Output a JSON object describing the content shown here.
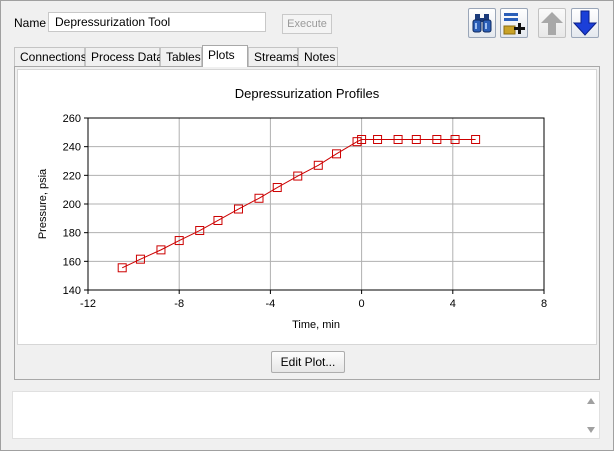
{
  "header": {
    "name_label": "Name",
    "name_value": "Depressurization Tool",
    "execute_label": "Execute"
  },
  "toolbar": {
    "icons": [
      "binoculars-icon",
      "add-note-icon",
      "arrow-up-icon",
      "arrow-down-icon"
    ]
  },
  "tabs": [
    {
      "label": "Connections"
    },
    {
      "label": "Process Data"
    },
    {
      "label": "Tables"
    },
    {
      "label": "Plots",
      "active": true
    },
    {
      "label": "Streams"
    },
    {
      "label": "Notes"
    }
  ],
  "chart_data": {
    "type": "line",
    "title": "Depressurization Profiles",
    "xlabel": "Time, min",
    "ylabel": "Pressure, psia",
    "xlim": [
      -12,
      8
    ],
    "ylim": [
      140,
      260
    ],
    "xticks": [
      -12,
      -8,
      -4,
      0,
      4,
      8
    ],
    "yticks": [
      140,
      160,
      180,
      200,
      220,
      240,
      260
    ],
    "grid": true,
    "color": "#cc0000",
    "series": [
      {
        "marker": "square",
        "x": [
          -10.5,
          -9.7,
          -8.8,
          -8.0,
          -7.1,
          -6.3,
          -5.4,
          -4.5,
          -3.7,
          -2.8,
          -1.9,
          -1.1,
          -0.2,
          0.0,
          0.7,
          1.6,
          2.4,
          3.3,
          4.1,
          5.0
        ],
        "y": [
          155.5,
          161.5,
          168,
          174.5,
          181.5,
          188.5,
          196.5,
          204,
          211.5,
          219.5,
          227,
          235,
          243.5,
          245,
          245,
          245,
          245,
          245,
          245,
          245
        ]
      }
    ]
  },
  "edit_plot_label": "Edit Plot..."
}
